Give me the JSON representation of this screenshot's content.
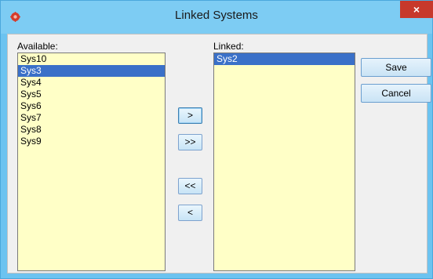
{
  "window": {
    "title": "Linked Systems",
    "close_glyph": "×",
    "icon": "app-gear-icon"
  },
  "available": {
    "label": "Available:",
    "items": [
      "Sys10",
      "Sys3",
      "Sys4",
      "Sys5",
      "Sys6",
      "Sys7",
      "Sys8",
      "Sys9"
    ],
    "selected": "Sys3"
  },
  "linked": {
    "label": "Linked:",
    "items": [
      "Sys2"
    ],
    "selected": "Sys2"
  },
  "movers": {
    "add_one": ">",
    "add_all": ">>",
    "remove_all": "<<",
    "remove_one": "<"
  },
  "actions": {
    "save": "Save",
    "cancel": "Cancel"
  },
  "colors": {
    "titlebar": "#7dccf3",
    "list_background": "#ffffc7",
    "selection": "#3a70c8",
    "close_button": "#c7392b"
  }
}
